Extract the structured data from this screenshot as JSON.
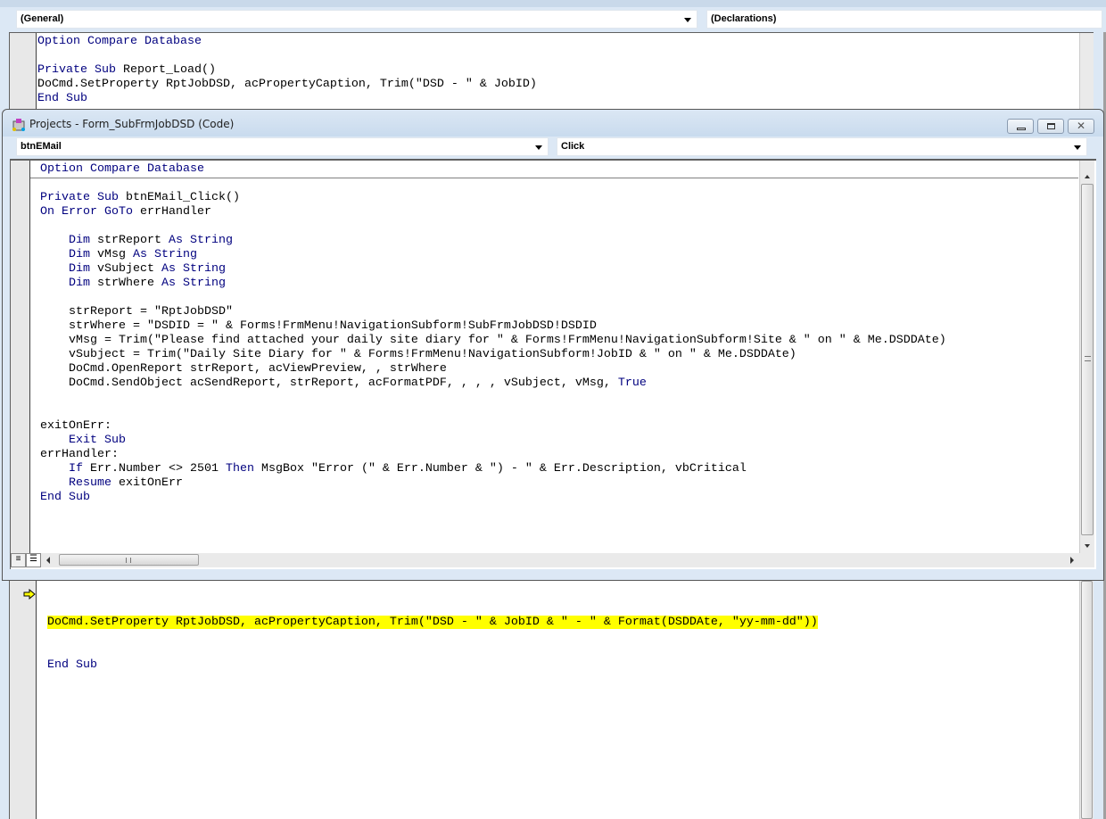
{
  "bg_window": {
    "object_combo": "(General)",
    "proc_combo": "(Declarations)",
    "code_top": [
      [
        [
          "Option Compare Database",
          "k"
        ]
      ],
      [],
      [
        [
          "Private Sub",
          "k"
        ],
        [
          " Report_Load()",
          "t"
        ]
      ],
      [
        [
          "DoCmd.SetProperty RptJobDSD, acPropertyCaption, Trim(\"DSD - \" & JobID)",
          "t"
        ]
      ],
      [
        [
          "End Sub",
          "k"
        ]
      ]
    ],
    "current_line": "DoCmd.SetProperty RptJobDSD, acPropertyCaption, Trim(\"DSD - \" & JobID & \" - \" & Format(DSDDAte, \"yy-mm-dd\"))",
    "code_bottom": [
      [
        [
          "End Sub",
          "k"
        ]
      ]
    ]
  },
  "fg_window": {
    "title": "Projects - Form_SubFrmJobDSD (Code)",
    "object_combo": "btnEMail",
    "proc_combo": "Click",
    "code": [
      [
        [
          "Option Compare Database",
          "k"
        ]
      ],
      [],
      [
        [
          "Private Sub",
          "k"
        ],
        [
          " btnEMail_Click()",
          "t"
        ]
      ],
      [
        [
          "On Error GoTo",
          "k"
        ],
        [
          " errHandler",
          "t"
        ]
      ],
      [],
      [
        [
          "    ",
          "t"
        ],
        [
          "Dim",
          "k"
        ],
        [
          " strReport ",
          "t"
        ],
        [
          "As String",
          "k"
        ]
      ],
      [
        [
          "    ",
          "t"
        ],
        [
          "Dim",
          "k"
        ],
        [
          " vMsg ",
          "t"
        ],
        [
          "As String",
          "k"
        ]
      ],
      [
        [
          "    ",
          "t"
        ],
        [
          "Dim",
          "k"
        ],
        [
          " vSubject ",
          "t"
        ],
        [
          "As String",
          "k"
        ]
      ],
      [
        [
          "    ",
          "t"
        ],
        [
          "Dim",
          "k"
        ],
        [
          " strWhere ",
          "t"
        ],
        [
          "As String",
          "k"
        ]
      ],
      [],
      [
        [
          "    strReport = \"RptJobDSD\"",
          "t"
        ]
      ],
      [
        [
          "    strWhere = \"DSDID = \" & Forms!FrmMenu!NavigationSubform!SubFrmJobDSD!DSDID",
          "t"
        ]
      ],
      [
        [
          "    vMsg = Trim(\"Please find attached your daily site diary for \" & Forms!FrmMenu!NavigationSubform!Site & \" on \" & Me.DSDDAte)",
          "t"
        ]
      ],
      [
        [
          "    vSubject = Trim(\"Daily Site Diary for \" & Forms!FrmMenu!NavigationSubform!JobID & \" on \" & Me.DSDDAte)",
          "t"
        ]
      ],
      [
        [
          "    DoCmd.OpenReport strReport, acViewPreview, , strWhere",
          "t"
        ]
      ],
      [
        [
          "    DoCmd.SendObject acSendReport, strReport, acFormatPDF, , , , vSubject, vMsg, ",
          "t"
        ],
        [
          "True",
          "k"
        ]
      ],
      [],
      [],
      [
        [
          "exitOnErr:",
          "t"
        ]
      ],
      [
        [
          "    ",
          "t"
        ],
        [
          "Exit Sub",
          "k"
        ]
      ],
      [
        [
          "errHandler:",
          "t"
        ]
      ],
      [
        [
          "    ",
          "t"
        ],
        [
          "If",
          "k"
        ],
        [
          " Err.Number <> 2501 ",
          "t"
        ],
        [
          "Then",
          "k"
        ],
        [
          " MsgBox \"Error (\" & Err.Number & \") - \" & Err.Description, vbCritical",
          "t"
        ]
      ],
      [
        [
          "    ",
          "t"
        ],
        [
          "Resume",
          "k"
        ],
        [
          " exitOnErr",
          "t"
        ]
      ],
      [
        [
          "End Sub",
          "k"
        ]
      ]
    ]
  },
  "colors": {
    "keyword": "#00007f",
    "highlight": "#ffff00"
  }
}
